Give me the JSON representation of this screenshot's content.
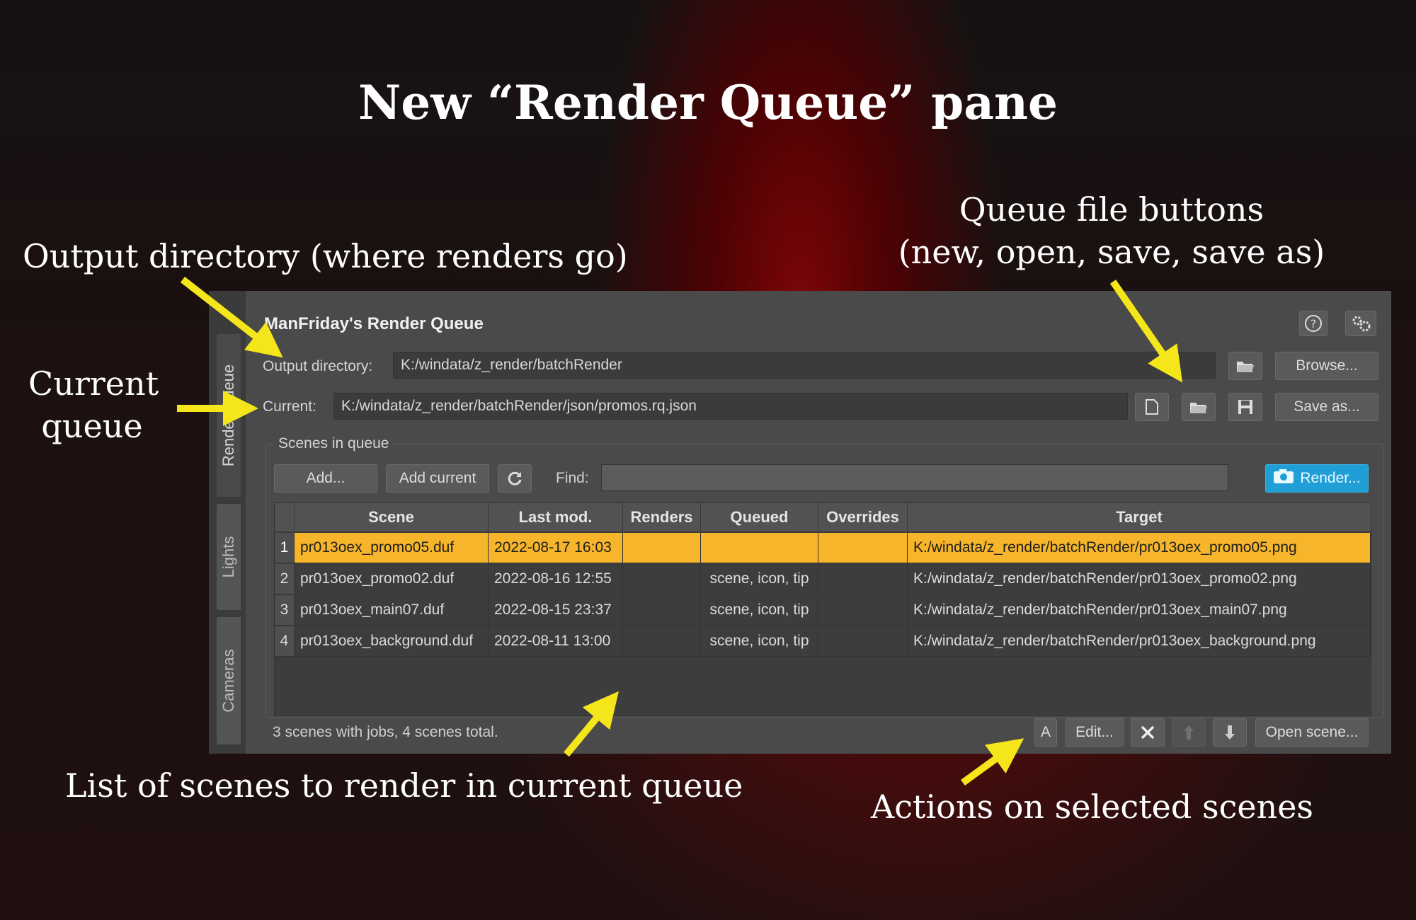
{
  "slide": {
    "title": "New “Render Queue” pane",
    "notes": {
      "output_directory": "Output directory (where renders go)",
      "current_queue_line1": "Current",
      "current_queue_line2": "queue",
      "queue_buttons_line1": "Queue file buttons",
      "queue_buttons_line2": "(new, open, save, save as)",
      "scene_list": "List of scenes to render in current queue",
      "actions": "Actions on selected scenes"
    },
    "arrow_color": "#f5e61b"
  },
  "panel": {
    "title": "ManFriday's Render Queue",
    "side_tabs": [
      "Render Queue",
      "Lights",
      "Cameras"
    ],
    "output_directory": {
      "label": "Output directory:",
      "value": "K:/windata/z_render/batchRender",
      "browse_label": "Browse..."
    },
    "current": {
      "label": "Current:",
      "value": "K:/windata/z_render/batchRender/json/promos.rq.json",
      "save_as_label": "Save as..."
    },
    "scenes_group": {
      "title": "Scenes in queue",
      "add_label": "Add...",
      "add_current_label": "Add current",
      "find_label": "Find:",
      "find_value": "",
      "render_label": "Render..."
    },
    "table": {
      "columns": [
        "Scene",
        "Last mod.",
        "Renders",
        "Queued",
        "Overrides",
        "Target"
      ],
      "rows": [
        {
          "n": "1",
          "scene": "pr013oex_promo05.duf",
          "last_mod": "2022-08-17 16:03",
          "renders": "",
          "queued": "",
          "overrides": "",
          "target": "K:/windata/z_render/batchRender/pr013oex_promo05.png",
          "selected": true
        },
        {
          "n": "2",
          "scene": "pr013oex_promo02.duf",
          "last_mod": "2022-08-16 12:55",
          "renders": "",
          "queued": "scene, icon, tip",
          "overrides": "",
          "target": "K:/windata/z_render/batchRender/pr013oex_promo02.png",
          "selected": false
        },
        {
          "n": "3",
          "scene": "pr013oex_main07.duf",
          "last_mod": "2022-08-15 23:37",
          "renders": "",
          "queued": "scene, icon, tip",
          "overrides": "",
          "target": "K:/windata/z_render/batchRender/pr013oex_main07.png",
          "selected": false
        },
        {
          "n": "4",
          "scene": "pr013oex_background.duf",
          "last_mod": "2022-08-11 13:00",
          "renders": "",
          "queued": "scene, icon, tip",
          "overrides": "",
          "target": "K:/windata/z_render/batchRender/pr013oex_background.png",
          "selected": false
        }
      ],
      "selected_color": "#f6b52a"
    },
    "status": "3 scenes with jobs, 4 scenes total.",
    "actions": {
      "a_label": "A",
      "edit_label": "Edit...",
      "open_scene_label": "Open scene..."
    },
    "icons": [
      "help-icon",
      "settings-gears-icon",
      "open-folder-icon",
      "new-file-icon",
      "save-disk-icon",
      "refresh-icon",
      "camera-icon",
      "delete-x-icon",
      "move-up-icon",
      "move-down-icon"
    ],
    "accent": "#1f9fd6"
  }
}
